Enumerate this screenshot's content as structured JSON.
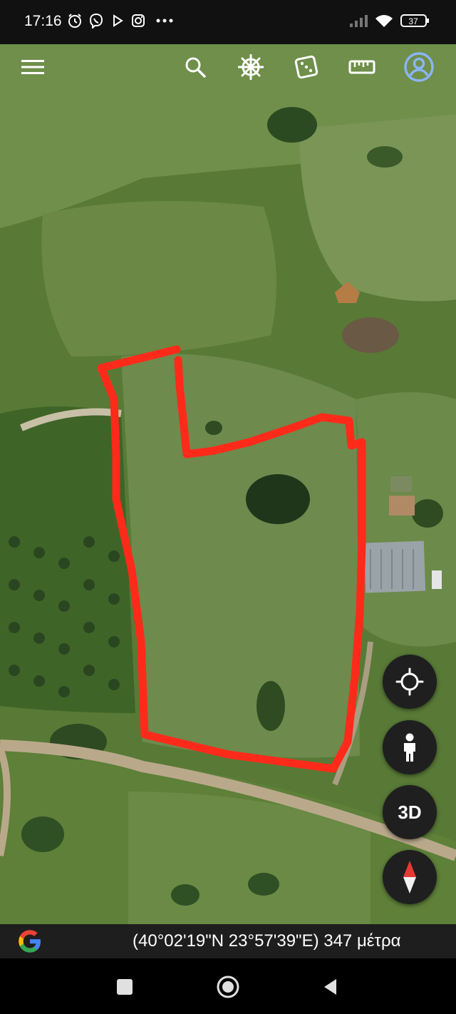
{
  "status_bar": {
    "time": "17:16",
    "battery": "37",
    "icons": [
      "alarm-icon",
      "viber-icon",
      "play-icon",
      "instagram-icon",
      "more-dots-icon",
      "signal-icon",
      "wifi-icon",
      "battery-icon"
    ]
  },
  "toolbar": {
    "icons": [
      "menu-icon",
      "search-icon",
      "voyager-wheel-icon",
      "feeling-lucky-dice-icon",
      "measure-ruler-icon",
      "account-icon"
    ]
  },
  "map_controls": {
    "label_3d": "3D",
    "icons": [
      "my-location-icon",
      "pegman-icon",
      "compass-icon"
    ]
  },
  "footer": {
    "coordinates": "(40°02'19\"N 23°57'39\"E) 347 μέτρα",
    "logo": "google-g-logo"
  },
  "colors": {
    "boundary_line": "#ff2a1a",
    "account_accent": "#8ab4f8"
  },
  "nav_bar": {
    "icons": [
      "recents-square-icon",
      "home-circle-icon",
      "back-triangle-icon"
    ]
  }
}
